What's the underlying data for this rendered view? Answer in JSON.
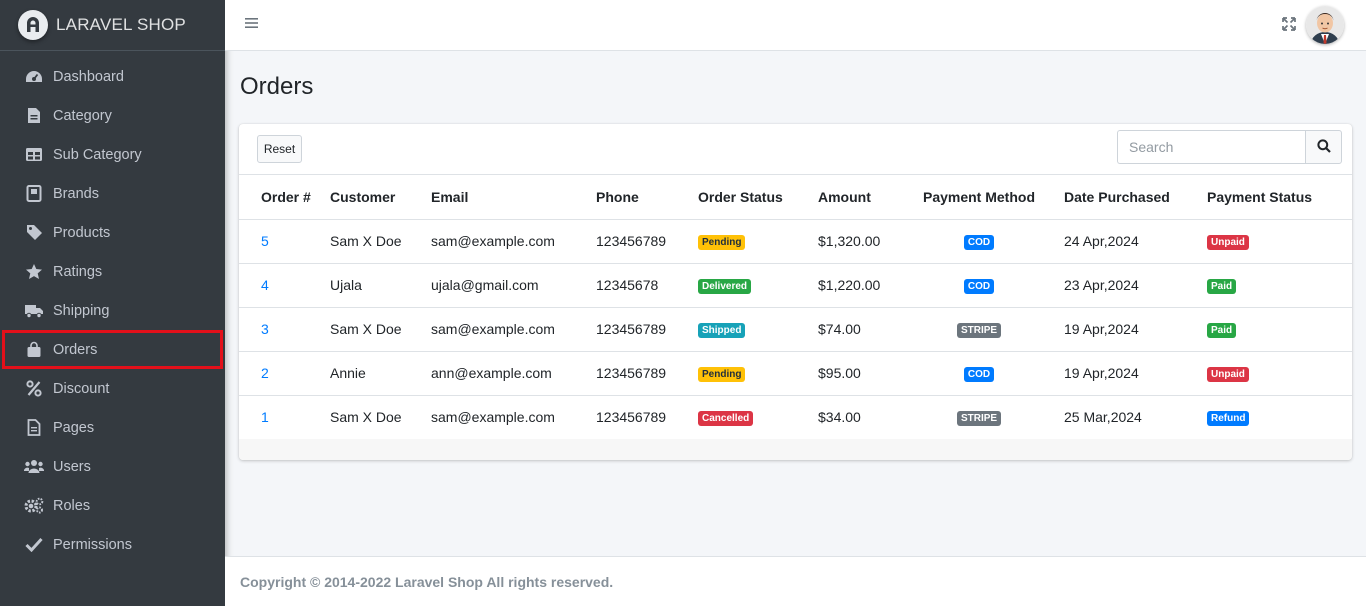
{
  "brand": {
    "name": "LARAVEL SHOP",
    "logo_icon": "laravel-logo-icon"
  },
  "sidebar": {
    "items": [
      {
        "label": "Dashboard",
        "icon": "tachometer-icon"
      },
      {
        "label": "Category",
        "icon": "file-icon"
      },
      {
        "label": "Sub Category",
        "icon": "table-icon"
      },
      {
        "label": "Brands",
        "icon": "book-icon"
      },
      {
        "label": "Products",
        "icon": "tag-icon"
      },
      {
        "label": "Ratings",
        "icon": "star-icon"
      },
      {
        "label": "Shipping",
        "icon": "truck-icon"
      },
      {
        "label": "Orders",
        "icon": "shopping-bag-icon",
        "active": true
      },
      {
        "label": "Discount",
        "icon": "percent-icon"
      },
      {
        "label": "Pages",
        "icon": "file-alt-icon"
      },
      {
        "label": "Users",
        "icon": "users-icon"
      },
      {
        "label": "Roles",
        "icon": "cogs-icon"
      },
      {
        "label": "Permissions",
        "icon": "check-icon"
      }
    ]
  },
  "page": {
    "title": "Orders"
  },
  "toolbar": {
    "reset_label": "Reset",
    "search_placeholder": "Search"
  },
  "table": {
    "headers": [
      "Order #",
      "Customer",
      "Email",
      "Phone",
      "Order Status",
      "Amount",
      "Payment Method",
      "Date Purchased",
      "Payment Status"
    ],
    "rows": [
      {
        "order": "5",
        "customer": "Sam X Doe",
        "email": "sam@example.com",
        "phone": "123456789",
        "status": "Pending",
        "amount": "$1,320.00",
        "method": "COD",
        "date": "24 Apr,2024",
        "payment": "Unpaid"
      },
      {
        "order": "4",
        "customer": "Ujala",
        "email": "ujala@gmail.com",
        "phone": "12345678",
        "status": "Delivered",
        "amount": "$1,220.00",
        "method": "COD",
        "date": "23 Apr,2024",
        "payment": "Paid"
      },
      {
        "order": "3",
        "customer": "Sam X Doe",
        "email": "sam@example.com",
        "phone": "123456789",
        "status": "Shipped",
        "amount": "$74.00",
        "method": "STRIPE",
        "date": "19 Apr,2024",
        "payment": "Paid"
      },
      {
        "order": "2",
        "customer": "Annie",
        "email": "ann@example.com",
        "phone": "123456789",
        "status": "Pending",
        "amount": "$95.00",
        "method": "COD",
        "date": "19 Apr,2024",
        "payment": "Unpaid"
      },
      {
        "order": "1",
        "customer": "Sam X Doe",
        "email": "sam@example.com",
        "phone": "123456789",
        "status": "Cancelled",
        "amount": "$34.00",
        "method": "STRIPE",
        "date": "25 Mar,2024",
        "payment": "Refund"
      }
    ]
  },
  "footer": {
    "text": "Copyright © 2014-2022 Laravel Shop All rights reserved."
  },
  "colors": {
    "sidebar_bg": "#343a40",
    "active_outline": "#e3101a",
    "link": "#007bff",
    "warning": "#ffc107",
    "success": "#28a745",
    "info": "#17a2b8",
    "danger": "#dc3545",
    "secondary": "#6c757d"
  }
}
